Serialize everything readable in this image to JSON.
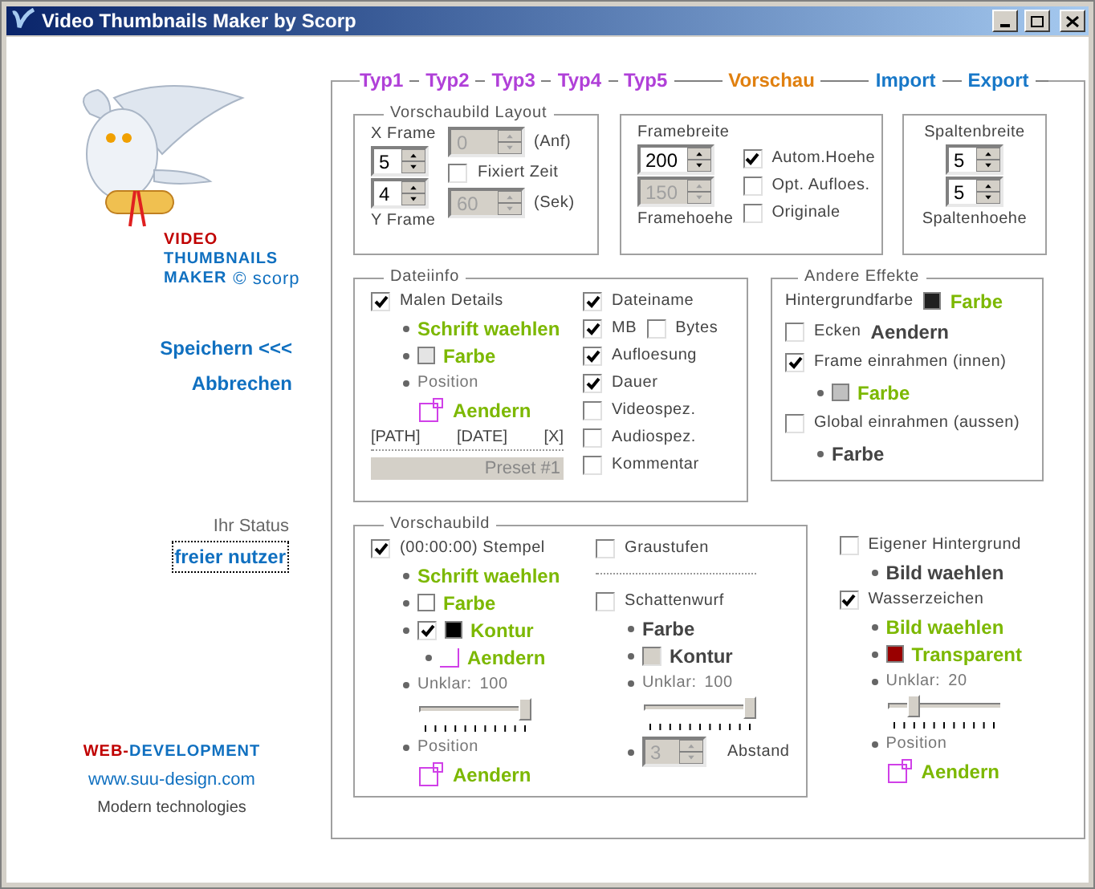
{
  "window": {
    "title": "Video Thumbnails Maker by Scorp"
  },
  "sidebar": {
    "logo": {
      "line_1": "VIDEO",
      "line_2": "THUMBNAILS",
      "line_3": "MAKER",
      "credit": "© scorp"
    },
    "links": [
      {
        "label": "Speichern <<<"
      },
      {
        "label": "Abbrechen"
      }
    ],
    "status": {
      "label": "Ihr Status",
      "value": "freier nutzer"
    },
    "footer": {
      "brand_1": "WEB-",
      "brand_2": "DEVELOPMENT",
      "url": "www.suu-design.com",
      "tagline": "Modern technologies"
    }
  },
  "nav_tabs": [
    {
      "label": "Typ1",
      "kind": "type"
    },
    {
      "label": "Typ2",
      "kind": "type"
    },
    {
      "label": "Typ3",
      "kind": "type"
    },
    {
      "label": "Typ4",
      "kind": "type"
    },
    {
      "label": "Typ5",
      "kind": "type"
    },
    {
      "label": "Vorschau",
      "kind": "preview"
    },
    {
      "label": "Import",
      "kind": "io"
    },
    {
      "label": "Export",
      "kind": "io"
    }
  ],
  "layout": {
    "title": "Vorschaubild Layout",
    "x_frame": {
      "label": "X Frame",
      "value": "5",
      "disabled": false
    },
    "y_frame": {
      "label": "Y Frame",
      "value": "4",
      "disabled": false
    },
    "start": {
      "value": "0",
      "disabled": true,
      "unit": "(Anf)"
    },
    "fixed_time": {
      "label": "Fixiert Zeit",
      "checked": false
    },
    "seconds": {
      "value": "60",
      "disabled": true,
      "unit": "(Sek)"
    }
  },
  "frame": {
    "width_label": "Framebreite",
    "width": {
      "value": "200",
      "disabled": false
    },
    "height": {
      "value": "150",
      "disabled": true
    },
    "height_label": "Framehoehe",
    "options": [
      {
        "label": "Autom.Hoehe",
        "checked": true
      },
      {
        "label": "Opt. Aufloes.",
        "checked": false
      },
      {
        "label": "Originale",
        "checked": false
      }
    ]
  },
  "columns": {
    "width_label": "Spaltenbreite",
    "width": {
      "value": "5",
      "disabled": false
    },
    "height": {
      "value": "5",
      "disabled": false
    },
    "height_label": "Spaltenhoehe"
  },
  "file_info": {
    "title": "Dateiinfo",
    "details": {
      "label": "Malen Details",
      "checked": true
    },
    "font_link": "Schrift waehlen",
    "color": {
      "label": "Farbe",
      "color": "#e4e4e4"
    },
    "position_label": "Position",
    "position_link": "Aendern",
    "tokens": [
      "[PATH]",
      "[DATE]",
      "[X]"
    ],
    "preset": "Preset #1",
    "fields": [
      {
        "label": "Dateiname",
        "checked": true
      },
      {
        "label": "MB",
        "checked": true,
        "extra": {
          "label": "Bytes",
          "checked": false
        }
      },
      {
        "label": "Aufloesung",
        "checked": true
      },
      {
        "label": "Dauer",
        "checked": true
      },
      {
        "label": "Videospez.",
        "checked": false
      },
      {
        "label": "Audiospez.",
        "checked": false
      },
      {
        "label": "Kommentar",
        "checked": false
      }
    ]
  },
  "effects": {
    "title": "Andere Effekte",
    "background": {
      "label": "Hintergrundfarbe",
      "color": "#202020",
      "link": "Farbe"
    },
    "corners": {
      "label": "Ecken",
      "checked": false,
      "link": "Aendern"
    },
    "inner_frame": {
      "label": "Frame einrahmen (innen)",
      "checked": true,
      "color": "#c0c0c0",
      "link": "Farbe"
    },
    "outer_frame": {
      "label": "Global einrahmen (aussen)",
      "checked": false,
      "link": "Farbe"
    }
  },
  "preview": {
    "title": "Vorschaubild",
    "stamp": {
      "label": "(00:00:00) Stempel",
      "checked": true
    },
    "font_link": "Schrift waehlen",
    "color": {
      "label": "Farbe",
      "color": "#ffffff"
    },
    "contour": {
      "label": "Kontur",
      "checked": true,
      "color": "#000000"
    },
    "contour_link": "Aendern",
    "blur": {
      "label": "Unklar:",
      "value": "100",
      "level": 1
    },
    "position_label": "Position",
    "position_link": "Aendern",
    "grayscale": {
      "label": "Graustufen",
      "checked": false
    },
    "shadow": {
      "label": "Schattenwurf",
      "checked": false
    },
    "shadow_color": "Farbe",
    "shadow_contour": {
      "label": "Kontur",
      "checked": false,
      "disabled": true
    },
    "shadow_blur": {
      "label": "Unklar:",
      "value": "100",
      "level": 1
    },
    "distance": {
      "label": "Abstand",
      "value": "3",
      "disabled": true
    }
  },
  "watermark": {
    "own_background": {
      "label": "Eigener Hintergrund",
      "checked": false,
      "link": "Bild waehlen"
    },
    "watermark": {
      "label": "Wasserzeichen",
      "checked": true,
      "image_link": "Bild waehlen"
    },
    "transparent": {
      "label": "Transparent",
      "color": "#990000"
    },
    "blur": {
      "label": "Unklar:",
      "value": "20",
      "level": 0.2
    },
    "position_label": "Position",
    "position_link": "Aendern"
  }
}
